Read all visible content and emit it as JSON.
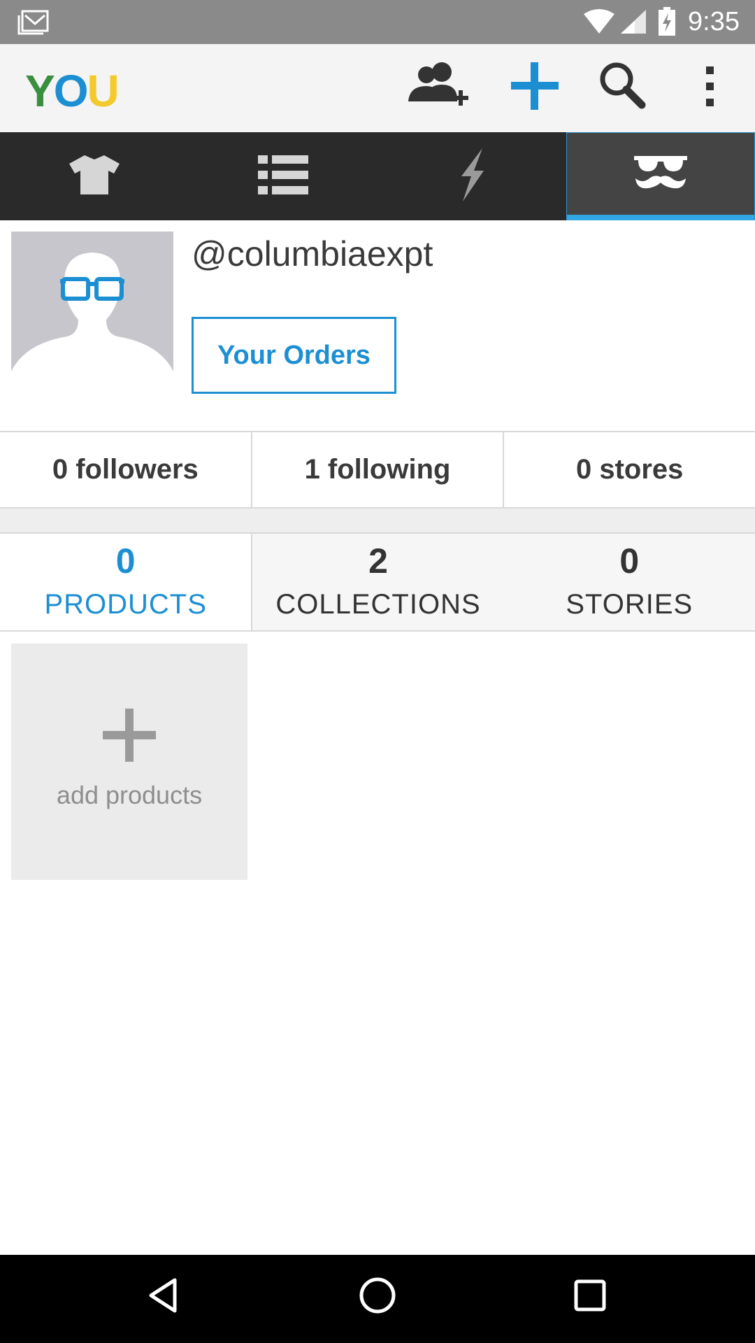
{
  "status_bar": {
    "time": "9:35",
    "icons": [
      "gmail-icon",
      "wifi-icon",
      "signal-icon",
      "battery-charging-icon"
    ]
  },
  "app_bar": {
    "logo": {
      "letters": [
        "Y",
        "O",
        "U"
      ],
      "colors": [
        "#3a8f3f",
        "#1c8fd3",
        "#f3c92b"
      ]
    },
    "actions": [
      "add-friend-icon",
      "plus-icon",
      "search-icon",
      "overflow-menu-icon"
    ],
    "accent": "#1c8fd3"
  },
  "tabs": [
    {
      "icon": "tshirt-icon",
      "active": false
    },
    {
      "icon": "list-icon",
      "active": false
    },
    {
      "icon": "lightning-icon",
      "active": false
    },
    {
      "icon": "sunglasses-mustache-icon",
      "active": true
    }
  ],
  "profile": {
    "username": "@columbiaexpt",
    "orders_button": "Your Orders"
  },
  "stats": [
    {
      "label": "0 followers"
    },
    {
      "label": "1 following"
    },
    {
      "label": "0 stores"
    }
  ],
  "counts": [
    {
      "number": "0",
      "label": "PRODUCTS",
      "selected": true
    },
    {
      "number": "2",
      "label": "COLLECTIONS",
      "selected": false
    },
    {
      "number": "0",
      "label": "STORIES",
      "selected": false
    }
  ],
  "add_tile": {
    "label": "add products"
  },
  "nav_bar": [
    "back-icon",
    "home-icon",
    "recents-icon"
  ]
}
